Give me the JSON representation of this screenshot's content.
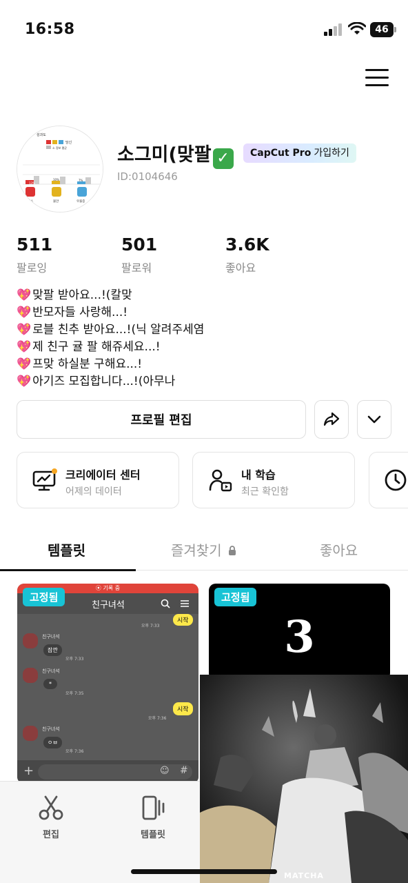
{
  "status_bar": {
    "time": "16:58",
    "battery": "46"
  },
  "profile": {
    "name": "소그미(맞팔",
    "verified_mark": "✓",
    "pro_badge": {
      "brand": "CapCut Pro",
      "action": "가입하기"
    },
    "user_id": "ID:0104646",
    "avatar_chart": {
      "title": "성과도",
      "legend": [
        "당신",
        "소 정보 평균"
      ],
      "bars": [
        "13%",
        "10%",
        "7%"
      ],
      "labels": [
        "레스",
        "물안",
        "우울증"
      ]
    }
  },
  "stats": [
    {
      "value": "511",
      "label": "팔로잉"
    },
    {
      "value": "501",
      "label": "팔로워"
    },
    {
      "value": "3.6K",
      "label": "좋아요"
    }
  ],
  "bio": [
    "맞팔 받아요...!(칼맞",
    "반모자들 사랑해...!",
    "로블 친추 받아요...!(닉 알려주세염",
    "제 친구 귤 팔 해쥬세요...!",
    "프맞 하실분 구해요...!",
    "아기즈 모집합니다...!(아무나"
  ],
  "bio_icon": "sparkling-heart-icon",
  "buttons": {
    "edit_profile": "프로필 편집"
  },
  "cards": {
    "creator": {
      "title": "크리에이터 센터",
      "subtitle": "어제의 데이터"
    },
    "learning": {
      "title": "내 학습",
      "subtitle": "최근 확인함"
    }
  },
  "tabs": [
    {
      "label": "템플릿",
      "active": true
    },
    {
      "label": "즐겨찾기",
      "active": false
    },
    {
      "label": "좋아요",
      "active": false
    }
  ],
  "thumbnails": [
    {
      "pinned": "고정됨",
      "recording_text": "⦿ 기록 중",
      "chat_title": "친구녀석",
      "messages": [
        {
          "side": "right",
          "text": "시작",
          "time": "오후 7:33"
        },
        {
          "side": "left",
          "name": "친구녀석",
          "text": "잠깐",
          "time": "오후 7:33"
        },
        {
          "side": "left",
          "name": "친구녀석",
          "text": "*",
          "time": "오후 7:35"
        },
        {
          "side": "right",
          "text": "시작",
          "time": "오후 7:36"
        },
        {
          "side": "left",
          "name": "친구녀석",
          "text": "ㅇㅂ",
          "time": "오후 7:36"
        }
      ]
    },
    {
      "pinned": "고정됨",
      "big_text": "3"
    }
  ],
  "bottom_nav": [
    {
      "label": "편집",
      "icon": "scissors-icon"
    },
    {
      "label": "템플릿",
      "icon": "template-icon"
    }
  ],
  "video_overlay": {
    "caption": "MATCHA"
  },
  "colors": {
    "pinned_badge": "#18c3d5",
    "verified": "#3aa84a",
    "heart": "#e8449a",
    "creator_dot": "#f5a623"
  }
}
